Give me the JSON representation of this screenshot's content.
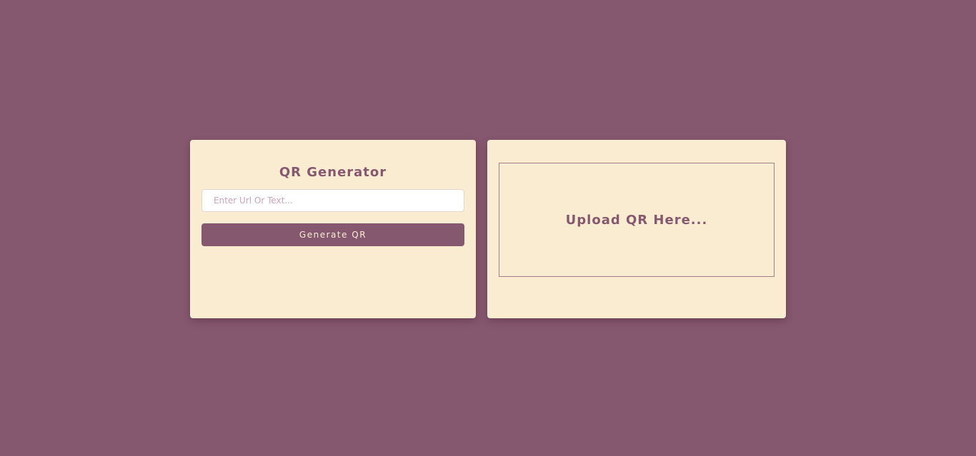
{
  "colors": {
    "background": "#86586f",
    "card": "#f9ecd1",
    "accent": "#86586f",
    "button_text": "#f9ecd1"
  },
  "generator": {
    "title": "QR Generator",
    "input": {
      "value": "",
      "placeholder": "Enter Url Or Text..."
    },
    "button_label": "Generate QR"
  },
  "uploader": {
    "label": "Upload QR Here..."
  }
}
